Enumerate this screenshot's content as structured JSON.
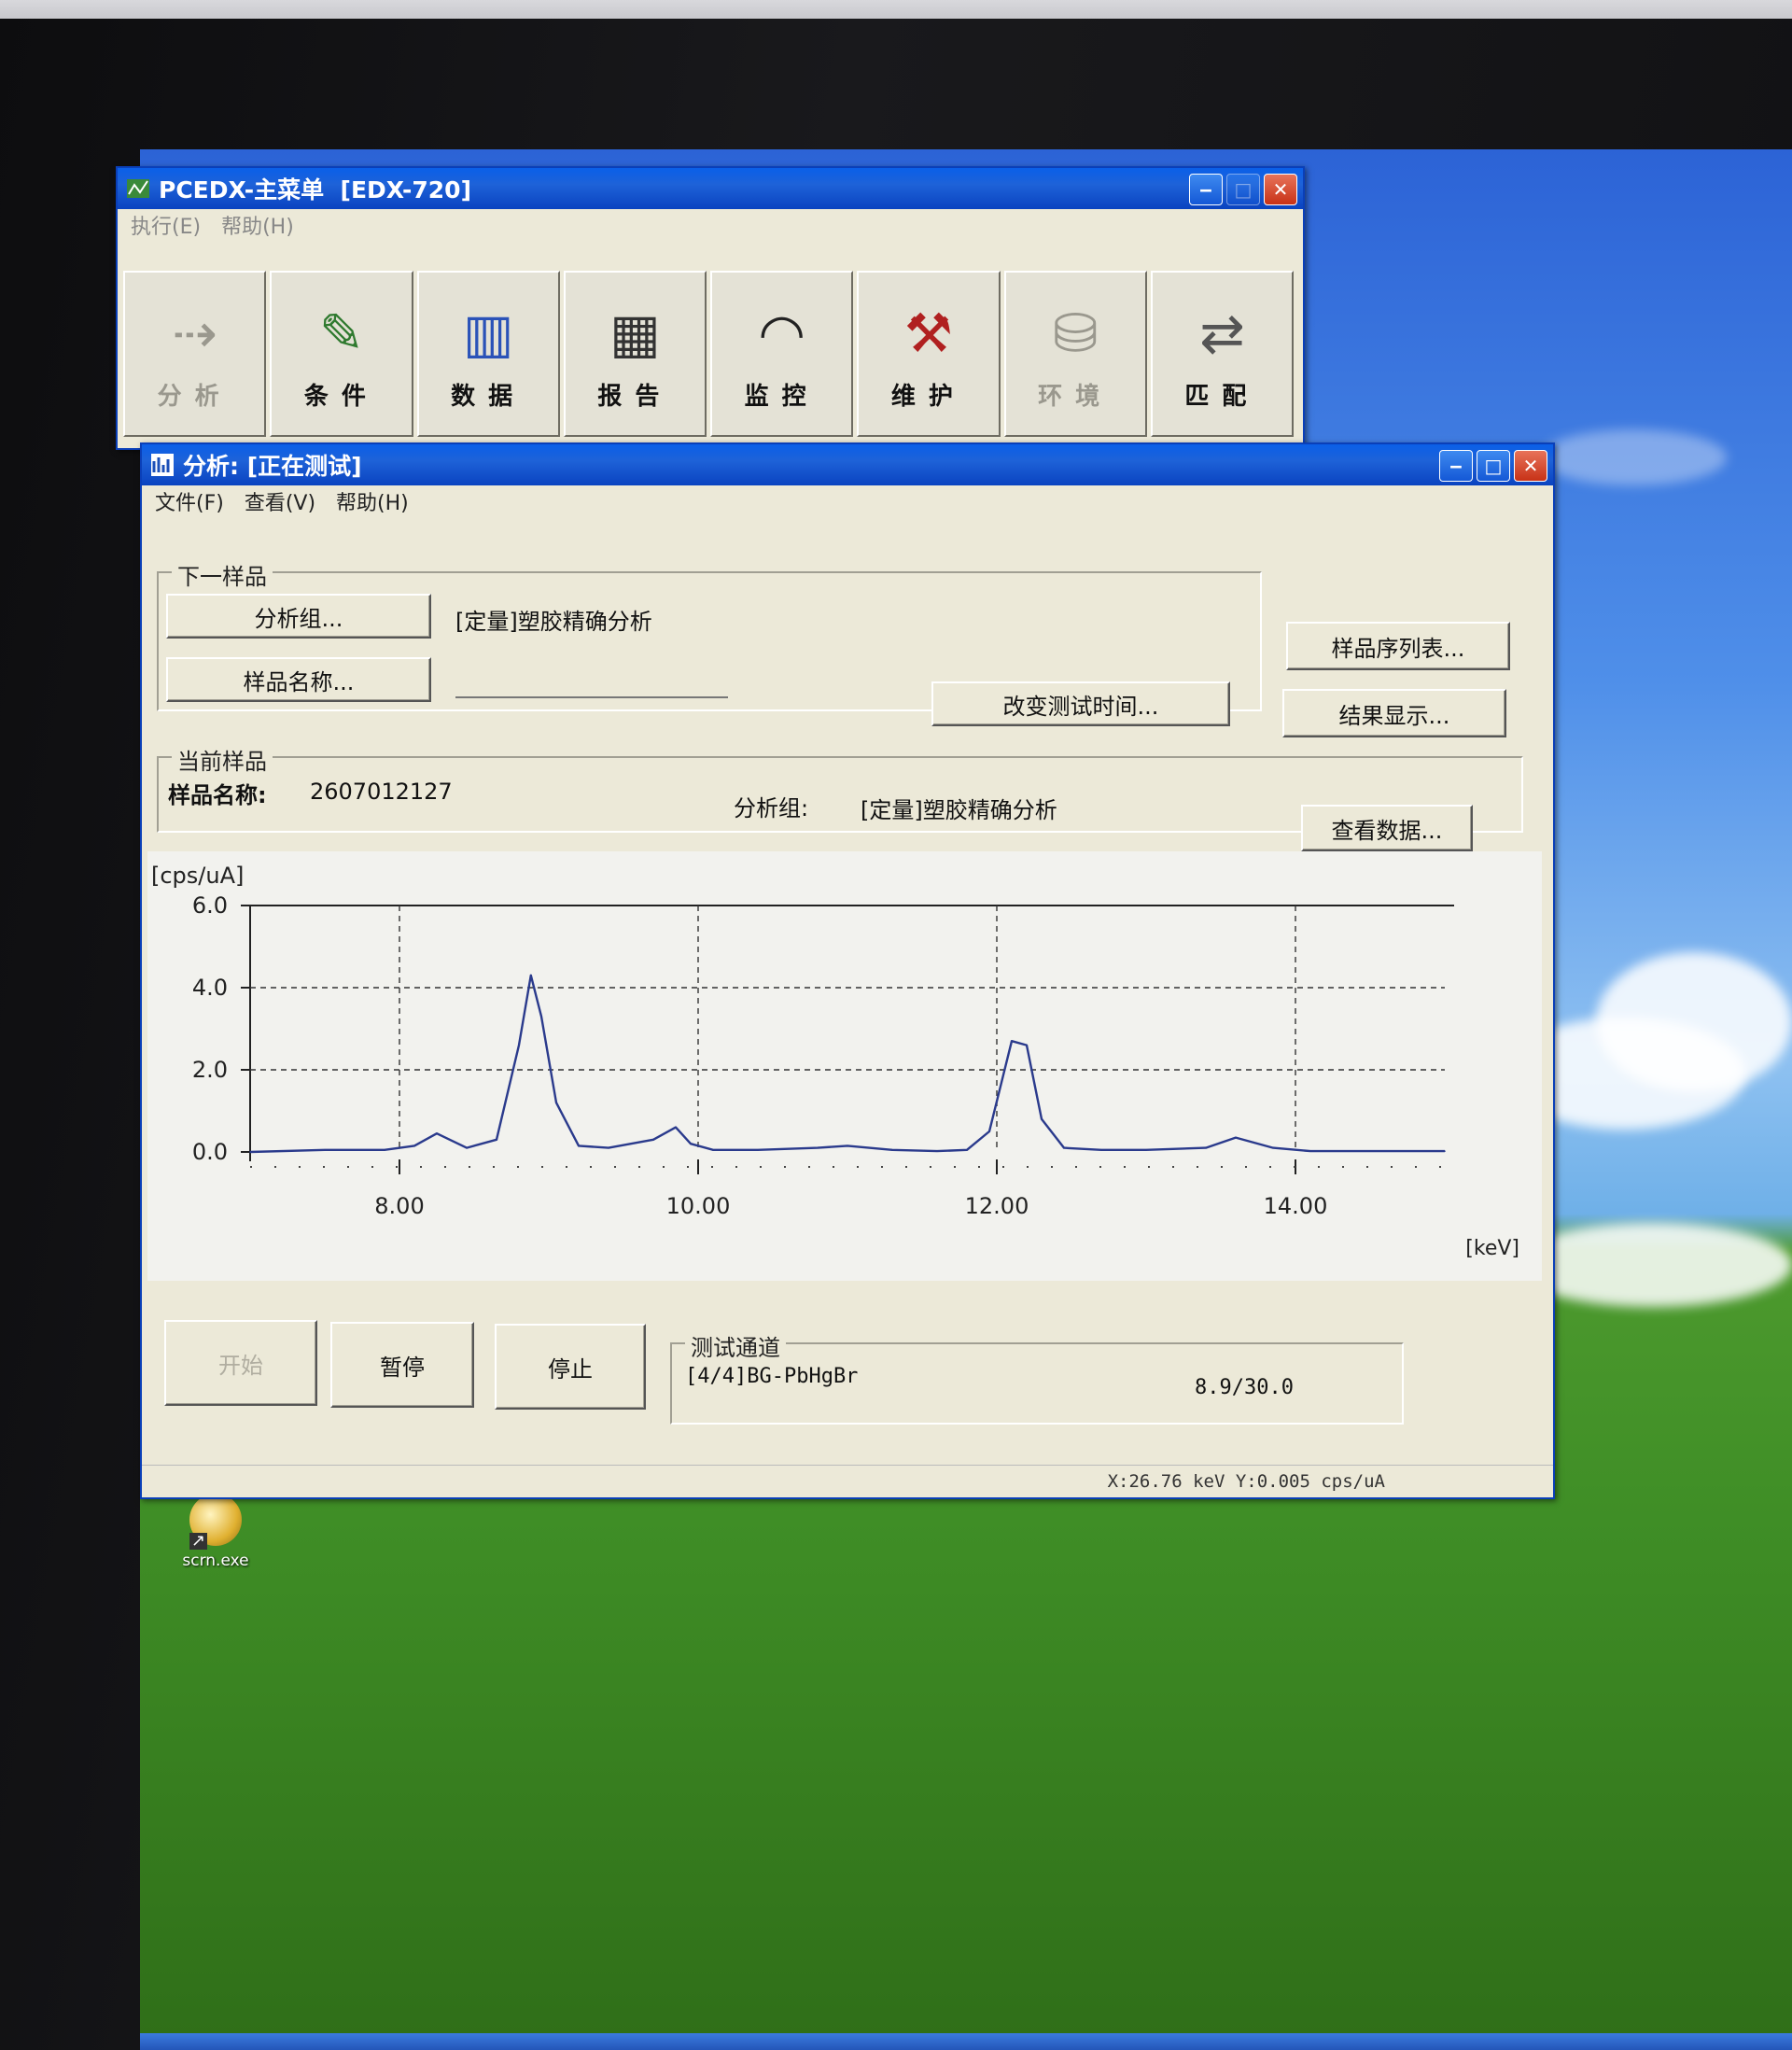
{
  "main_window": {
    "title": "PCEDX-主菜单  [EDX-720]",
    "menu": [
      "执行(E)",
      "帮助(H)"
    ],
    "toolbar": [
      {
        "label": "分析",
        "icon": "spectrum-arrow-icon",
        "glyph": "⇢",
        "enabled": false
      },
      {
        "label": "条件",
        "icon": "pencil-icon",
        "glyph": "✎",
        "enabled": true
      },
      {
        "label": "数据",
        "icon": "data-chart-icon",
        "glyph": "▥",
        "enabled": true
      },
      {
        "label": "报告",
        "icon": "report-table-icon",
        "glyph": "▦",
        "enabled": true
      },
      {
        "label": "监控",
        "icon": "gauge-icon",
        "glyph": "◠",
        "enabled": true
      },
      {
        "label": "维护",
        "icon": "tools-icon",
        "glyph": "⚒",
        "enabled": true
      },
      {
        "label": "环境",
        "icon": "disk-environment-icon",
        "glyph": "⛁",
        "enabled": false
      },
      {
        "label": "匹配",
        "icon": "match-icon",
        "glyph": "⇄",
        "enabled": true
      }
    ]
  },
  "analysis_window": {
    "title": "分析: [正在测试]",
    "menu": [
      "文件(F)",
      "查看(V)",
      "帮助(H)"
    ],
    "next_sample": {
      "group_title": "下一样品",
      "analysis_group_button": "分析组...",
      "analysis_group_value": "[定量]塑胶精确分析",
      "sample_name_button": "样品名称...",
      "sample_name_value": "",
      "change_time_button": "改变测试时间..."
    },
    "sample_list_button": "样品序列表...",
    "result_display_button": "结果显示...",
    "current_sample": {
      "group_title": "当前样品",
      "sample_name_label": "样品名称:",
      "sample_name_value": "2607012127",
      "analysis_group_label": "分析组:",
      "analysis_group_value": "[定量]塑胶精确分析",
      "view_data_button": "查看数据..."
    },
    "controls": {
      "start": "开始",
      "pause": "暂停",
      "stop": "停止"
    },
    "channel": {
      "group_title": "测试通道",
      "name": "[4/4]BG-PbHgBr",
      "progress": "8.9/30.0"
    },
    "status_bar": "X:26.76 keV  Y:0.005 cps/uA"
  },
  "desktop_icon": {
    "label": "scrn.exe"
  },
  "colors": {
    "spectrum": "#2a3a8c",
    "window_bg": "#ece9d8",
    "title_blue": "#0a4fd0"
  },
  "chart_data": {
    "type": "line",
    "ylabel": "[cps/uA]",
    "xlabel": "[keV]",
    "xlim": [
      7.0,
      15.0
    ],
    "ylim": [
      0.0,
      6.0
    ],
    "xticks": [
      "8.00",
      "10.00",
      "12.00",
      "14.00"
    ],
    "yticks": [
      "0.0",
      "2.0",
      "4.0",
      "6.0"
    ],
    "grid": true,
    "series": [
      {
        "x": [
          7.0,
          7.5,
          7.9,
          8.1,
          8.25,
          8.45,
          8.65,
          8.8,
          8.88,
          8.95,
          9.05,
          9.2,
          9.4,
          9.7,
          9.85,
          9.95,
          10.1,
          10.4,
          10.8,
          11.0,
          11.3,
          11.6,
          11.8,
          11.95,
          12.1,
          12.2,
          12.3,
          12.45,
          12.7,
          13.0,
          13.4,
          13.6,
          13.85,
          14.1,
          14.5,
          15.0
        ],
        "y": [
          0.0,
          0.05,
          0.05,
          0.15,
          0.45,
          0.1,
          0.3,
          2.6,
          4.3,
          3.3,
          1.2,
          0.15,
          0.1,
          0.3,
          0.6,
          0.2,
          0.05,
          0.05,
          0.1,
          0.15,
          0.05,
          0.02,
          0.05,
          0.5,
          2.7,
          2.6,
          0.8,
          0.1,
          0.05,
          0.05,
          0.1,
          0.35,
          0.1,
          0.02,
          0.02,
          0.02
        ]
      }
    ]
  }
}
